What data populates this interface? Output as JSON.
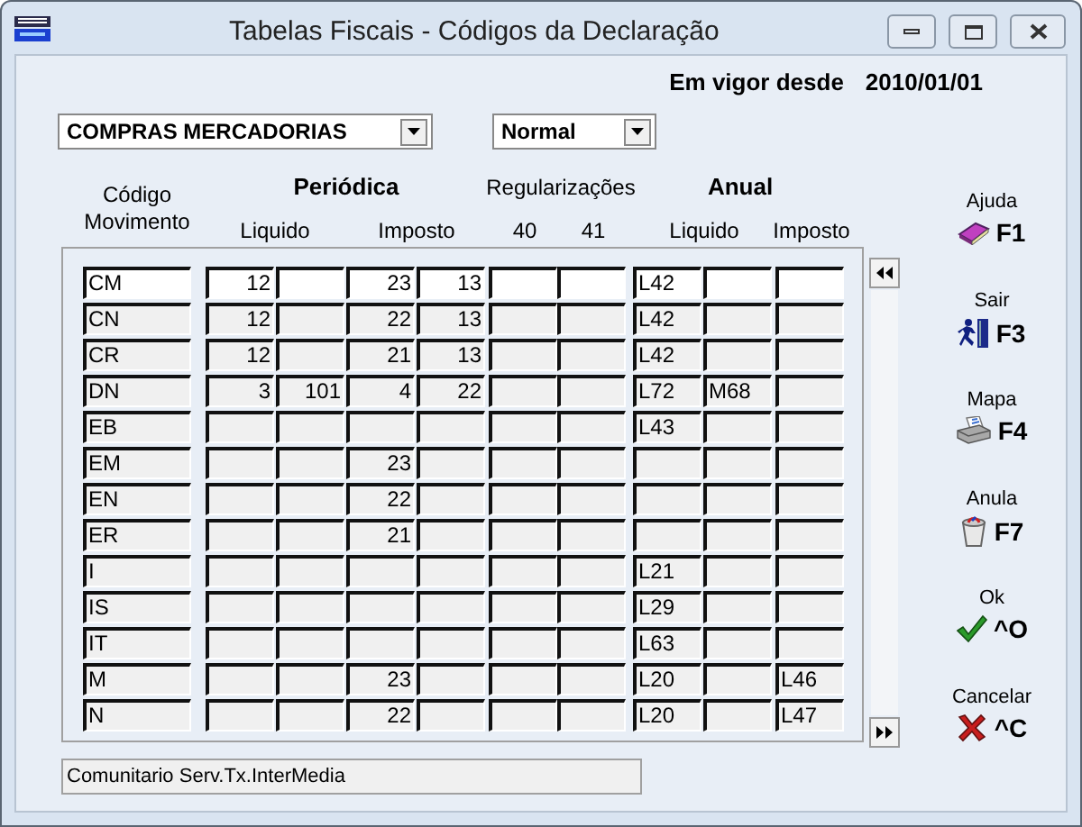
{
  "window": {
    "title": "Tabelas Fiscais - Códigos da Declaração"
  },
  "valid_since": {
    "label": "Em vigor desde",
    "value": "2010/01/01"
  },
  "dropdowns": [
    {
      "value": "COMPRAS MERCADORIAS"
    },
    {
      "value": "Normal"
    }
  ],
  "table": {
    "code_header": "Código Movimento",
    "groups": [
      {
        "label": "Periódica"
      },
      {
        "label": "Regularizações"
      },
      {
        "label": "Anual"
      }
    ],
    "subheaders": [
      "Liquido",
      "Imposto",
      "40",
      "41",
      "Liquido",
      "Imposto"
    ],
    "rows": [
      {
        "selected": true,
        "code": "CM",
        "periodica_liquido_1": "12",
        "periodica_imposto_1": "23",
        "periodica_imposto_2": "13",
        "anual_liquido_1": "L42"
      },
      {
        "selected": false,
        "code": "CN",
        "periodica_liquido_1": "12",
        "periodica_imposto_1": "22",
        "periodica_imposto_2": "13",
        "anual_liquido_1": "L42"
      },
      {
        "selected": false,
        "code": "CR",
        "periodica_liquido_1": "12",
        "periodica_imposto_1": "21",
        "periodica_imposto_2": "13",
        "anual_liquido_1": "L42"
      },
      {
        "selected": false,
        "code": "DN",
        "periodica_liquido_1": "3",
        "periodica_liquido_2": "101",
        "periodica_imposto_1": "4",
        "periodica_imposto_2": "22",
        "anual_liquido_1": "L72",
        "anual_liquido_2": "M68"
      },
      {
        "selected": false,
        "code": "EB",
        "anual_liquido_1": "L43"
      },
      {
        "selected": false,
        "code": "EM",
        "periodica_imposto_1": "23"
      },
      {
        "selected": false,
        "code": "EN",
        "periodica_imposto_1": "22"
      },
      {
        "selected": false,
        "code": "ER",
        "periodica_imposto_1": "21"
      },
      {
        "selected": false,
        "code": "I",
        "anual_liquido_1": "L21"
      },
      {
        "selected": false,
        "code": "IS",
        "anual_liquido_1": "L29"
      },
      {
        "selected": false,
        "code": "IT",
        "anual_liquido_1": "L63"
      },
      {
        "selected": false,
        "code": "M",
        "periodica_imposto_1": "23",
        "anual_liquido_1": "L20",
        "anual_imposto": "L46"
      },
      {
        "selected": false,
        "code": "N",
        "periodica_imposto_1": "22",
        "anual_liquido_1": "L20",
        "anual_imposto": "L47"
      }
    ]
  },
  "status_field": {
    "value": "Comunitario Serv.Tx.InterMedia"
  },
  "actions": [
    {
      "kind": "help",
      "label": "Ajuda",
      "shortcut": "F1"
    },
    {
      "kind": "exit",
      "label": "Sair",
      "shortcut": "F3"
    },
    {
      "kind": "print",
      "label": "Mapa",
      "shortcut": "F4"
    },
    {
      "kind": "cancel_entry",
      "label": "Anula",
      "shortcut": "F7"
    },
    {
      "kind": "ok",
      "label": "Ok",
      "shortcut": "^O"
    },
    {
      "kind": "close",
      "label": "Cancelar",
      "shortcut": "^C"
    }
  ]
}
